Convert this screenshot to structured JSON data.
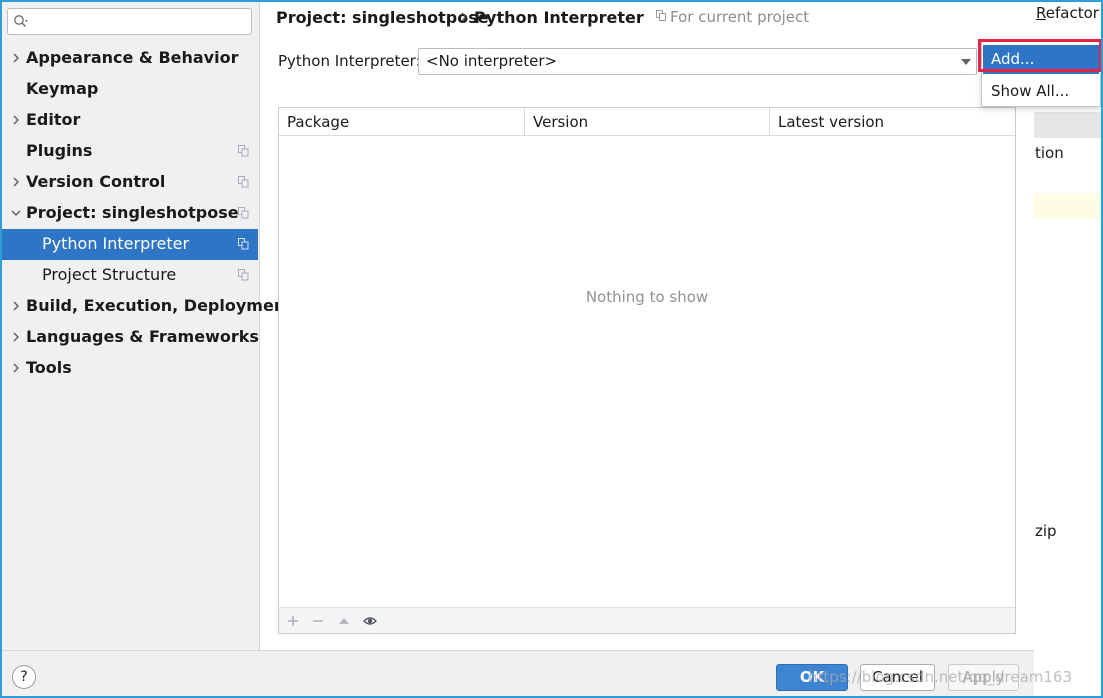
{
  "sidebar": {
    "search": {
      "value": "",
      "placeholder": ""
    },
    "items": [
      {
        "label": "Appearance & Behavior",
        "bold": true,
        "arrow": "right"
      },
      {
        "label": "Keymap",
        "bold": true,
        "arrow": "none"
      },
      {
        "label": "Editor",
        "bold": true,
        "arrow": "right"
      },
      {
        "label": "Plugins",
        "bold": true,
        "arrow": "none",
        "copy_icon": true
      },
      {
        "label": "Version Control",
        "bold": true,
        "arrow": "right",
        "copy_icon": true
      },
      {
        "label": "Project: singleshotpose",
        "bold": true,
        "arrow": "down",
        "copy_icon": true
      },
      {
        "label": "Python Interpreter",
        "bold": false,
        "arrow": "none",
        "copy_icon": true,
        "selected": true
      },
      {
        "label": "Project Structure",
        "bold": false,
        "arrow": "none",
        "copy_icon": true
      },
      {
        "label": "Build, Execution, Deployment",
        "bold": true,
        "arrow": "right"
      },
      {
        "label": "Languages & Frameworks",
        "bold": true,
        "arrow": "right"
      },
      {
        "label": "Tools",
        "bold": true,
        "arrow": "right"
      }
    ]
  },
  "breadcrumb": {
    "project": "Project: singleshotpose",
    "page": "Python Interpreter",
    "scope": "For current project"
  },
  "interpreter": {
    "label": "Python Interpreter:",
    "value": "<No interpreter>"
  },
  "packages": {
    "columns": [
      "Package",
      "Version",
      "Latest version"
    ],
    "rows": [],
    "empty_text": "Nothing to show"
  },
  "popup_menu": {
    "items": [
      "Add...",
      "Show All..."
    ],
    "selected": "Add..."
  },
  "background": {
    "refactor_menu": "Refactor",
    "text_tion": "tion",
    "text_zip": "zip"
  },
  "footer": {
    "help": "?",
    "ok": "OK",
    "cancel": "Cancel",
    "apply": "Apply"
  },
  "watermark": "https://blog.csdn.net/qq_dream163",
  "colors": {
    "accent": "#2f75c5",
    "highlight_border": "#e8234a",
    "window_border": "#2e9fd6"
  }
}
